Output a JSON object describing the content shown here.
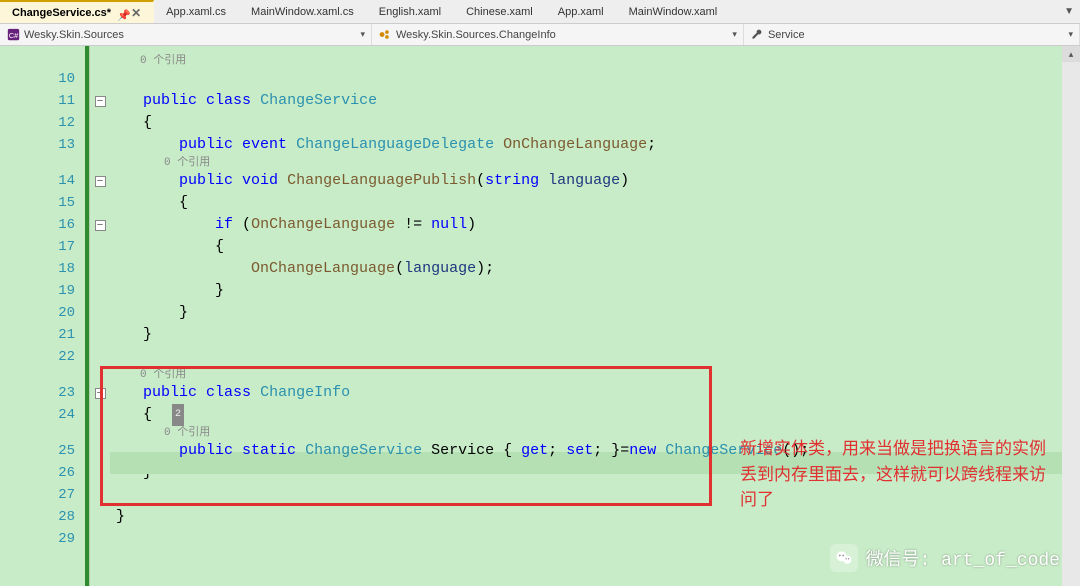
{
  "tabs": [
    {
      "label": "ChangeService.cs*",
      "active": true
    },
    {
      "label": "App.xaml.cs"
    },
    {
      "label": "MainWindow.xaml.cs"
    },
    {
      "label": "English.xaml"
    },
    {
      "label": "Chinese.xaml"
    },
    {
      "label": "App.xaml"
    },
    {
      "label": "MainWindow.xaml"
    }
  ],
  "nav": {
    "project": "Wesky.Skin.Sources",
    "class": "Wesky.Skin.Sources.ChangeInfo",
    "member": "Service"
  },
  "codelens": {
    "refs1": "0 个引用",
    "refs2": "0 个引用",
    "refs3": "0 个引用",
    "refs4": "0 个引用",
    "count": "2"
  },
  "line_numbers": [
    "10",
    "11",
    "12",
    "13",
    "14",
    "15",
    "16",
    "17",
    "18",
    "19",
    "20",
    "21",
    "22",
    "23",
    "24",
    "25",
    "26",
    "27",
    "28",
    "29"
  ],
  "code": {
    "kw_public": "public",
    "kw_class": "class",
    "kw_event": "event",
    "kw_void": "void",
    "kw_string": "string",
    "kw_if": "if",
    "kw_null": "null",
    "kw_static": "static",
    "kw_get": "get",
    "kw_set": "set",
    "kw_new": "new",
    "t_ChangeService": "ChangeService",
    "t_ChangeLanguageDelegate": "ChangeLanguageDelegate",
    "t_ChangeInfo": "ChangeInfo",
    "m_ChangeLanguagePublish": "ChangeLanguagePublish",
    "m_OnChangeLanguage": "OnChangeLanguage",
    "p_language": "language",
    "p_Service": "Service"
  },
  "annotation": "新增实体类，用来当做是把换语言的实例丢到内存里面去，这样就可以跨线程来访问了",
  "watermark": "微信号: art_of_code"
}
